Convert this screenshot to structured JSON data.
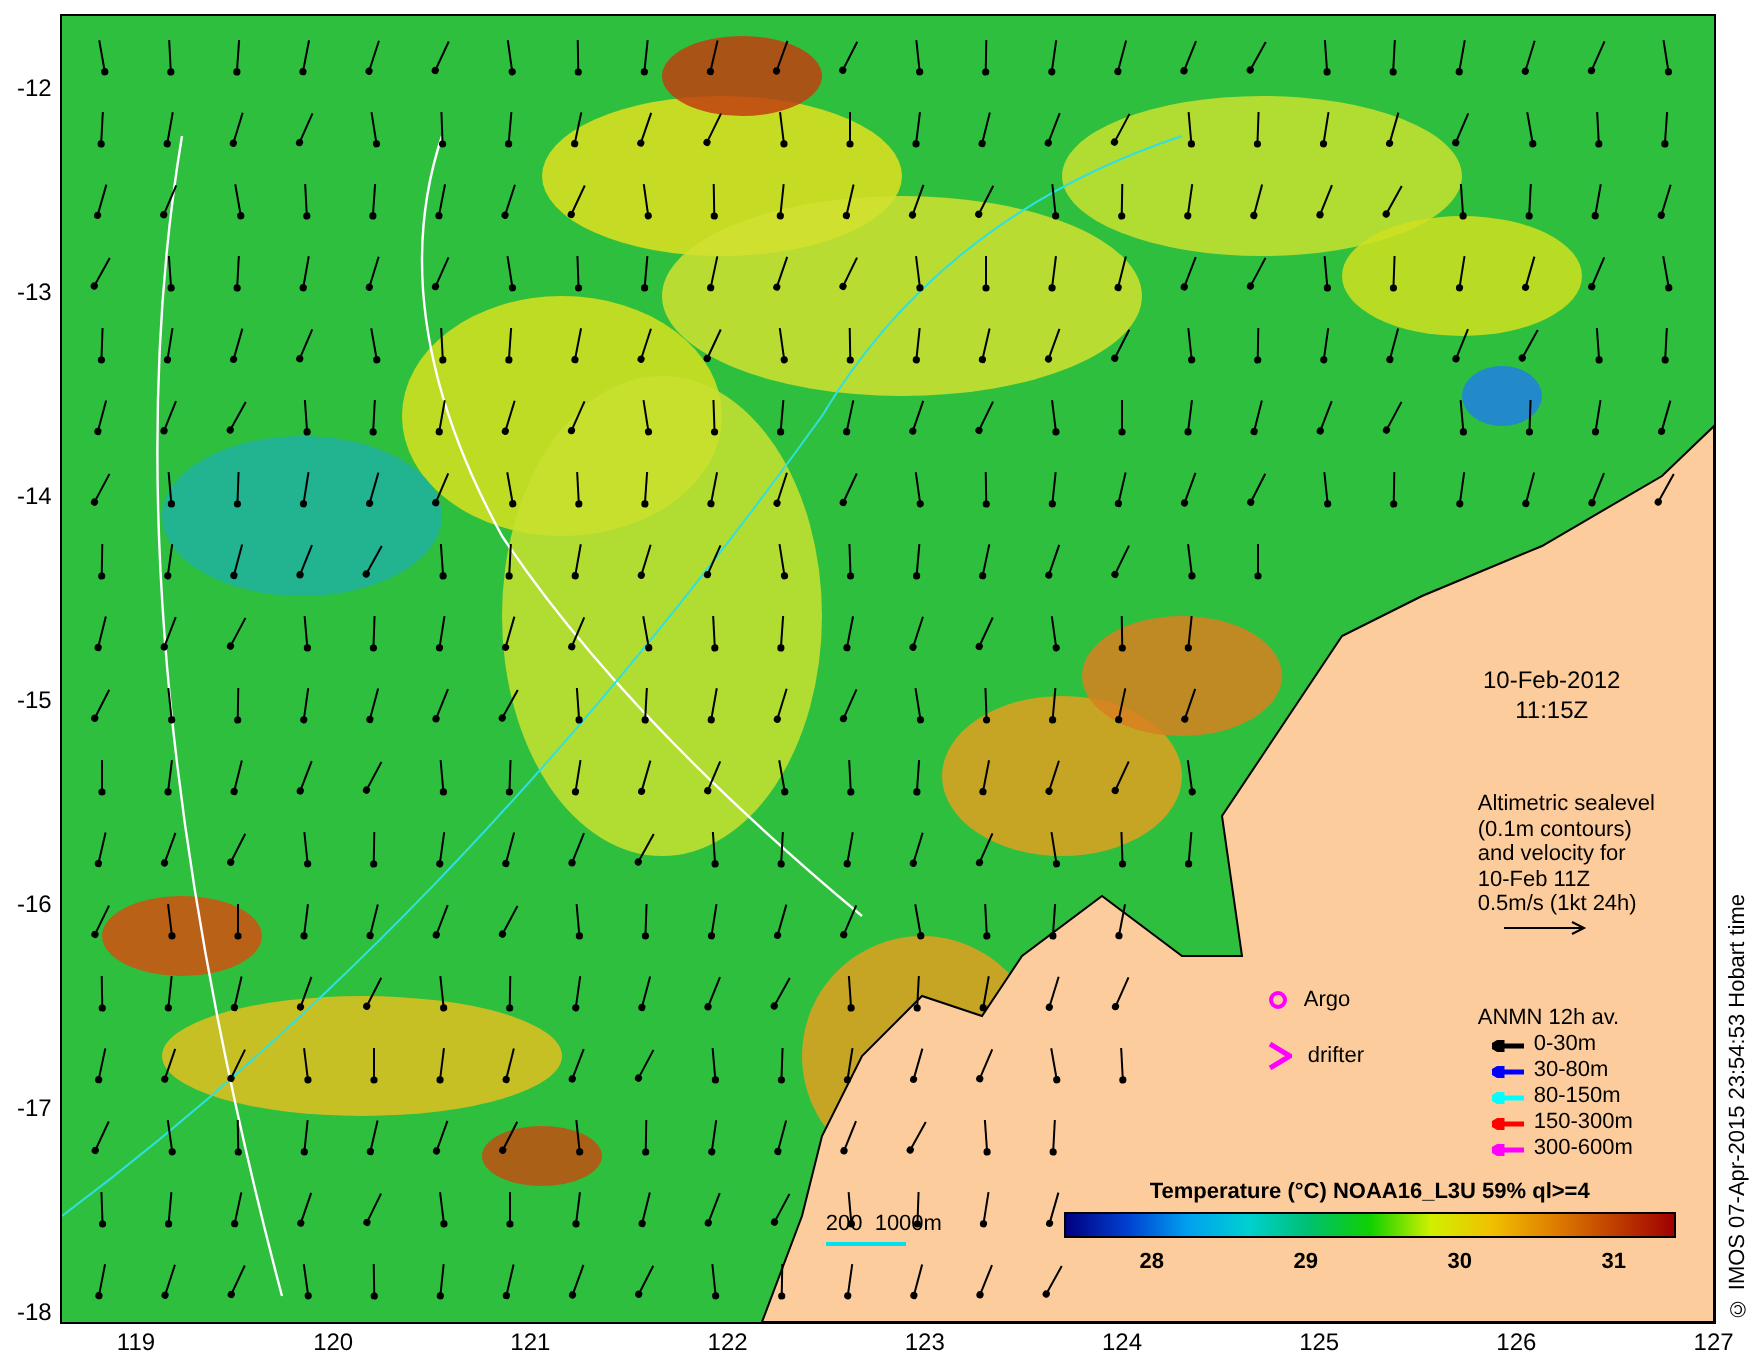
{
  "map": {
    "date": "10-Feb-2012",
    "time": "11:15Z",
    "altimetry_note": [
      "Altimetric sealevel",
      "(0.1m contours)",
      "and velocity for",
      "10-Feb 11Z",
      "0.5m/s (1kt 24h)"
    ],
    "markers": [
      {
        "kind": "circle",
        "label": "Argo",
        "color": "#ff00ff"
      },
      {
        "kind": "chevron",
        "label": "drifter",
        "color": "#ff00ff"
      }
    ],
    "depth_legend": {
      "title": "ANMN 12h av.",
      "items": [
        {
          "label": "0-30m",
          "color": "#000000"
        },
        {
          "label": "30-80m",
          "color": "#0000ff"
        },
        {
          "label": "80-150m",
          "color": "#00ffff"
        },
        {
          "label": "150-300m",
          "color": "#ff0000"
        },
        {
          "label": "300-600m",
          "color": "#ff00ff"
        }
      ]
    },
    "contour_scale": "200  1000m",
    "colorbar": {
      "title": "Temperature (°C) NOAA16_L3U 59% ql>=4",
      "ticks": [
        "28",
        "29",
        "30",
        "31"
      ]
    },
    "y_ticks": [
      "-12",
      "-13",
      "-14",
      "-15",
      "-16",
      "-17",
      "-18"
    ],
    "x_ticks": [
      "119",
      "120",
      "121",
      "122",
      "123",
      "124",
      "125",
      "126",
      "127"
    ],
    "credit": "© IMOS 07-Apr-2015 23:54:53 Hobart time"
  }
}
